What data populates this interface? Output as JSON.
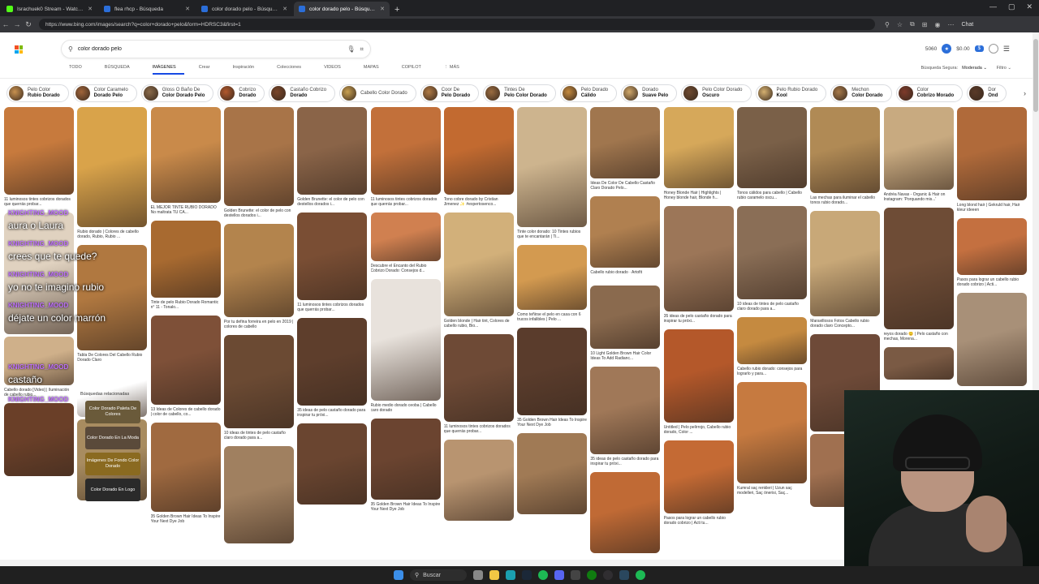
{
  "tabs": [
    {
      "label": "Israchuek0 Stream - Watch Live o...",
      "color": "#53fc18"
    },
    {
      "label": "flea rhcp - Búsqueda",
      "color": "#2b6ed9"
    },
    {
      "label": "color dorado pelo - Búsqueda",
      "color": "#2b6ed9"
    },
    {
      "label": "color dorado pelo - Búsqueda Inve...",
      "color": "#2b6ed9",
      "active": true
    }
  ],
  "address": {
    "url": "https://www.bing.com/images/search?q=color+dorado+pelo&form=HDRSC3&first=1"
  },
  "toolbar": {
    "chat_label": "Chat"
  },
  "search": {
    "value": "color dorado pelo"
  },
  "user": {
    "points": "5060",
    "rewards": "$0.00"
  },
  "nav": [
    "TODO",
    "BÚSQUEDA",
    "IMÁGENES",
    "Crear",
    "Inspiración",
    "Colecciones",
    "VIDEOS",
    "MAPAS",
    "COPILOT",
    "⋮ MÁS"
  ],
  "safesearch": {
    "label": "Búsqueda Segura:",
    "value": "Moderada ⌄"
  },
  "filter_label": "Filtro ⌄",
  "chips": [
    {
      "l1": "Pelo Color",
      "l2": "Rubio Dorado",
      "c": "#c8914f"
    },
    {
      "l1": "Color Caramelo",
      "l2": "Dorado Pelo",
      "c": "#a0643a"
    },
    {
      "l1": "Gloss O Baño De",
      "l2": "Color Dorado Pelo",
      "c": "#8a6a4a"
    },
    {
      "l1": "Cobrizo",
      "l2": "Dorado",
      "c": "#b3582c"
    },
    {
      "l1": "Castaño Cobrizo",
      "l2": "Dorado",
      "c": "#7a4528"
    },
    {
      "l1": "Cabello Color Dorado",
      "l2": "",
      "c": "#c9a050"
    },
    {
      "l1": "Coor De",
      "l2": "Pelo Dorado",
      "c": "#b07a45"
    },
    {
      "l1": "Tintes De",
      "l2": "Pelo Color Dorado",
      "c": "#9a6c40"
    },
    {
      "l1": "Pelo Dorado",
      "l2": "Cálido",
      "c": "#c58a3e"
    },
    {
      "l1": "Dorado",
      "l2": "Suave Pelo",
      "c": "#d1a86a"
    },
    {
      "l1": "Pelo Color Dorado",
      "l2": "Oscuro",
      "c": "#6e4a30"
    },
    {
      "l1": "Pelo Rubio Dorado",
      "l2": "Kool",
      "c": "#d5b070"
    },
    {
      "l1": "Mechon",
      "l2": "Color Dorado",
      "c": "#a77a4a"
    },
    {
      "l1": "Color",
      "l2": "Cobrizo Morado",
      "c": "#7e3a2a"
    },
    {
      "l1": "Dor",
      "l2": "Ond",
      "c": "#5a3a28"
    }
  ],
  "columns": [
    [
      {
        "h": 108,
        "c": "#c77a3d",
        "cap": "11 luminosos tintes cobrizos dorados que querrás probar..."
      },
      {
        "h": 150,
        "c": "#e0d2c0",
        "cap": ""
      },
      {
        "h": 60,
        "c": "#cfb08a",
        "cap": "Cabello dorado [Video] | Iluminación de cabello rubio..."
      },
      {
        "h": 90,
        "c": "#6a3f28",
        "cap": ""
      }
    ],
    [
      {
        "h": 148,
        "c": "#d9a34a",
        "cap": "Rubio dorado | Colores de cabello dorado, Rubio, Rubio ..."
      },
      {
        "h": 130,
        "c": "#b07840",
        "cap": "Tabla De Colores Del Cabello Rubio Dorado Claro"
      },
      {
        "h": 60,
        "c": "#ffffff",
        "cap": ""
      },
      {
        "h": 100,
        "c": "#a88c60",
        "cap": ""
      }
    ],
    [
      {
        "h": 118,
        "c": "#c98a4a",
        "cap": "EL MEJOR TINTE RUBIO DORADO No maltrata TU CA..."
      },
      {
        "h": 95,
        "c": "#a86a30",
        "cap": "Tinte de pelo Rubio Dorado Romantic n° 11 - Tonalo..."
      },
      {
        "h": 110,
        "c": "#7e5038",
        "cap": "13 Ideas de Colores de cabello dorado | color de cabello, co..."
      },
      {
        "h": 110,
        "c": "#a06a40",
        "cap": "35 Golden Brown Hair Ideas To Inspire Your Next Dye Job"
      }
    ],
    [
      {
        "h": 122,
        "c": "#a87448",
        "cap": "Golden Brunette: el color de pelo con destellos dorados i..."
      },
      {
        "h": 115,
        "c": "#b3844d",
        "cap": "Por tu defina forreira en pelo en 2019 | colores de cabello"
      },
      {
        "h": 115,
        "c": "#6b4a33",
        "cap": "10 ideas de tintes de pelo castaño claro dorado para a..."
      },
      {
        "h": 120,
        "c": "#a08060",
        "cap": ""
      }
    ],
    [
      {
        "h": 108,
        "c": "#8a6448",
        "cap": "Golden Brunette: el color de pelo con destellos dorados i..."
      },
      {
        "h": 108,
        "c": "#7a4e34",
        "cap": "11 luminosos tintes cobrizos dorados que querrás probar..."
      },
      {
        "h": 108,
        "c": "#5e3e2c",
        "cap": "35 ideas de pelo castaño dorado para inspirar tu próxi..."
      },
      {
        "h": 100,
        "c": "#6a4530",
        "cap": ""
      }
    ],
    [
      {
        "h": 108,
        "c": "#c2703a",
        "cap": "11 luminosos tintes cobrizos dorados que querrás probar..."
      },
      {
        "h": 60,
        "c": "#d08050",
        "cap": "Descubre el Encanto del Rubio Cobrizo Dorado: Consejos d..."
      },
      {
        "h": 150,
        "c": "#e8e2dc",
        "cap": "Rubio medio dorado ceoba | Cabello caro dorado"
      },
      {
        "h": 100,
        "c": "#6b4430",
        "cap": "35 Golden Brown Hair Ideas To Inspire Your Next Dye Job"
      }
    ],
    [
      {
        "h": 108,
        "c": "#c26a30",
        "cap": "Tono cobre dorado by Cristian Jimenez ✨ #expertosenco..."
      },
      {
        "h": 128,
        "c": "#d2b07a",
        "cap": "Golden blonde | Hair tint, Colores de cabello rubio, Bio..."
      },
      {
        "h": 108,
        "c": "#6e4a36",
        "cap": "11 luminosos tintes cobrizos dorados que querrás probar..."
      },
      {
        "h": 100,
        "c": "#b89470",
        "cap": ""
      }
    ],
    [
      {
        "h": 148,
        "c": "#cdb48e",
        "cap": "Tinte color dorado: 10 Tintes rubios que te encantarán | Ti..."
      },
      {
        "h": 80,
        "c": "#d39a50",
        "cap": "Como teñirse el pelo en casa con 6 trucos infalibles | Pelo ..."
      },
      {
        "h": 108,
        "c": "#5a3c2c",
        "cap": "35 Golden Brown Hair Ideas To Inspire Your Next Dye Job"
      },
      {
        "h": 100,
        "c": "#a07a55",
        "cap": ""
      }
    ],
    [
      {
        "h": 88,
        "c": "#a0764e",
        "cap": "Ideas De Color De Cabello Castaño Claro Dorado Pelo..."
      },
      {
        "h": 88,
        "c": "#b08050",
        "cap": "Cabello rubio dorado · Artofit"
      },
      {
        "h": 78,
        "c": "#8a6a4e",
        "cap": "10 Light Golden Brown Hair Color Ideas To Add Radianc..."
      },
      {
        "h": 108,
        "c": "#a07858",
        "cap": "35 ideas de pelo castaño dorado para inspirar tu próxi..."
      },
      {
        "h": 100,
        "c": "#c06a35",
        "cap": ""
      }
    ],
    [
      {
        "h": 100,
        "c": "#d6a85a",
        "cap": "Honey Blonde Hair | Highlights | Honey blonde hair, Blonde h..."
      },
      {
        "h": 130,
        "c": "#9c7658",
        "cap": "35 ideas de pelo castaño dorado para inspirar tu próxi..."
      },
      {
        "h": 115,
        "c": "#b4582a",
        "cap": "Untitled | Pelo pelirrojo, Cabello rubio dorado, Color ..."
      },
      {
        "h": 90,
        "c": "#c46a34",
        "cap": "Pasos para lograr un cabello rubio dorado cobrizo | Acti tu..."
      }
    ],
    [
      {
        "h": 100,
        "c": "#7a6048",
        "cap": "Tonos cálidos para cabello | Cabello rubio caramelo oscu..."
      },
      {
        "h": 115,
        "c": "#8a6e56",
        "cap": "10 ideas de tintes de pelo castaño claro dorado para a..."
      },
      {
        "h": 58,
        "c": "#c58a40",
        "cap": "Cabello rubio dorado: consejos para lograrlo y para..."
      },
      {
        "h": 125,
        "c": "#c67a40",
        "cap": "Kumral saç renkleri | Uzun saç modelleri, Saç önerisi, Saç..."
      }
    ],
    [
      {
        "h": 106,
        "c": "#b08a55",
        "cap": "Las mechas para iluminar el cabello tonos rubio dorado..."
      },
      {
        "h": 130,
        "c": "#c8a878",
        "cap": "Maravillosos Fotos Cabello rubio dorado claro Concepto..."
      },
      {
        "h": 120,
        "c": "#6e4a38",
        "cap": ""
      },
      {
        "h": 90,
        "c": "#a07050",
        "cap": ""
      }
    ],
    [
      {
        "h": 102,
        "c": "#c8aa80",
        "cap": "Andréa Navas - Organic & Hair on Instagram: 'Porquando mis...'"
      },
      {
        "h": 150,
        "c": "#6e4c36",
        "cap": "reyos dorado 😊 | Pelo castaño con mechas, Morena..."
      },
      {
        "h": 40,
        "c": "#7a5a44",
        "cap": ""
      }
    ],
    [
      {
        "h": 115,
        "c": "#b06a3a",
        "cap": "Long blond hair | Gekruld hair, Hair kleur ideeen"
      },
      {
        "h": 70,
        "c": "#c47040",
        "cap": "Pasos para lograr un cabello rubio dorado cobrizo | Acti..."
      },
      {
        "h": 115,
        "c": "#a89078",
        "cap": ""
      }
    ]
  ],
  "chat": [
    {
      "nick": "KNIGHTING_MOOD",
      "msg": "aura o Laura"
    },
    {
      "nick": "KNIGHTING_MOOD",
      "msg": "crees que te quede?"
    },
    {
      "nick": "KNIGHTING_MOOD",
      "msg": "yo no te imagino rubio"
    },
    {
      "nick": "KNIGHTING_MOOD",
      "msg": "déjate un color marrón"
    },
    {
      "nick": "KNIGHTING_MOOD",
      "msg": "castaño"
    },
    {
      "nick": "KNIGHTING_MOOD",
      "msg": ""
    }
  ],
  "related": {
    "title": "Búsquedas relacionadas",
    "items": [
      {
        "label": "Color Dorado Paleta De Colores",
        "c": "#6a5a3a"
      },
      {
        "label": "Color Dorado En La Moda",
        "c": "#5a4a3a"
      },
      {
        "label": "Imágenes De Fondo Color Dorado",
        "c": "#8a6a20"
      },
      {
        "label": "Color Dorado En Logo",
        "c": "#2a2a2a"
      }
    ]
  },
  "taskbar": {
    "search_label": "Buscar"
  }
}
